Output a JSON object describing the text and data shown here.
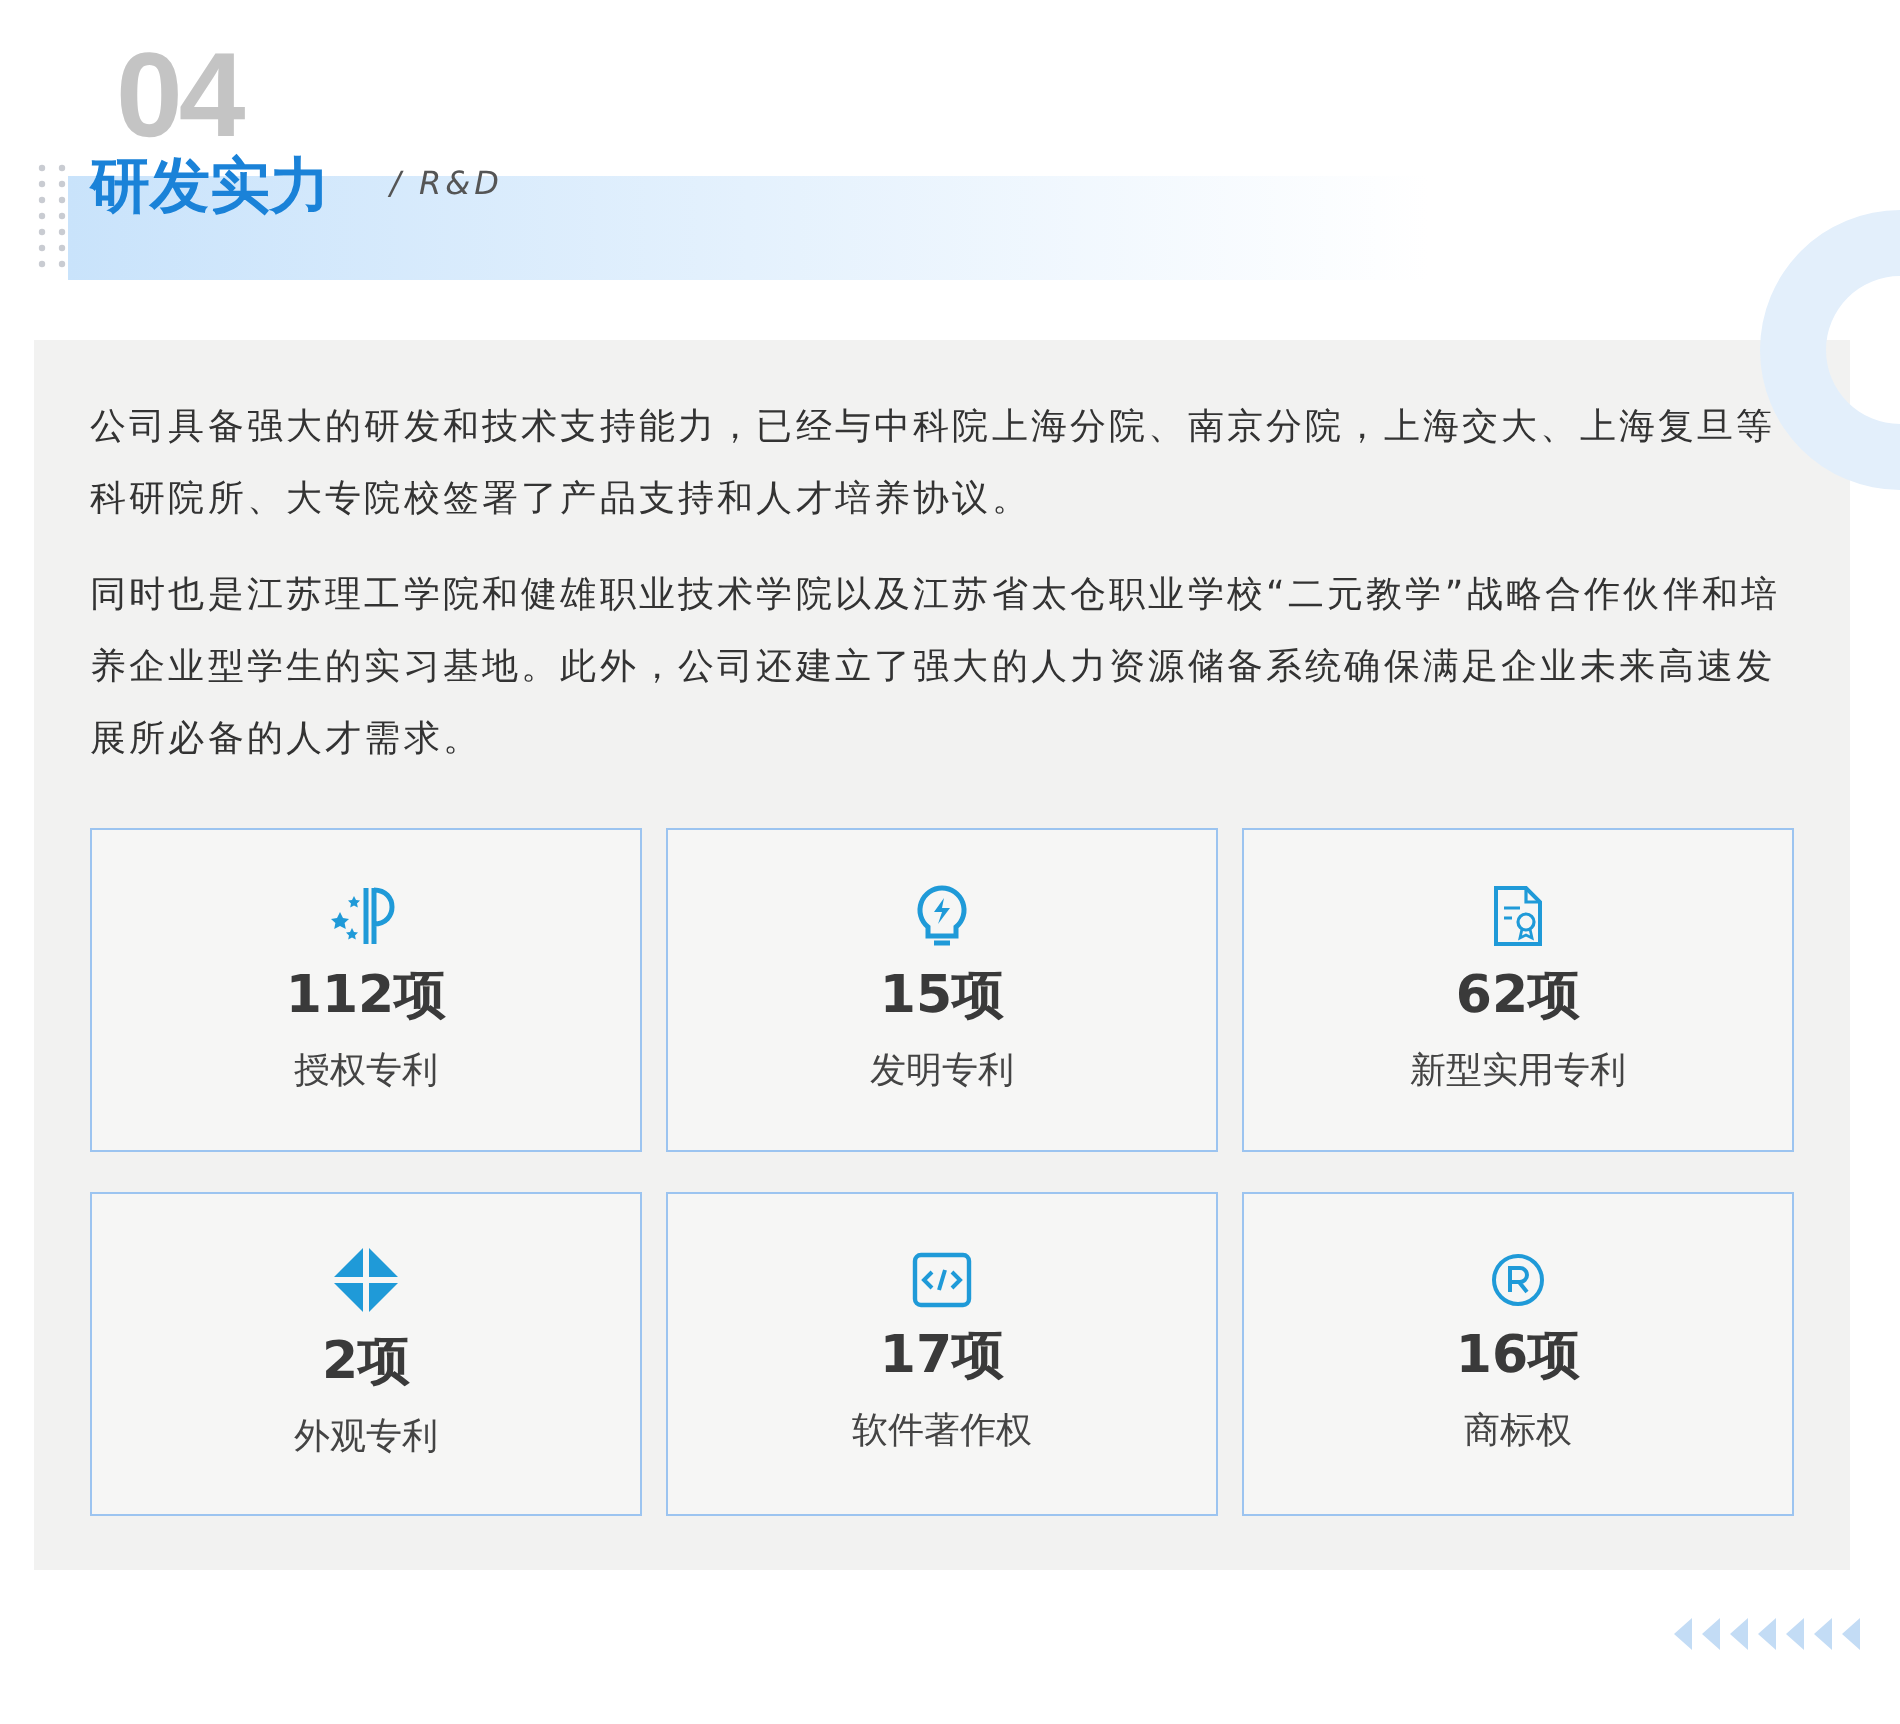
{
  "header": {
    "number": "04",
    "title": "研发实力",
    "subtitle": "/ R&D"
  },
  "paragraphs": [
    "公司具备强大的研发和技术支持能力，已经与中科院上海分院、南京分院，上海交大、上海复旦等科研院所、大专院校签署了产品支持和人才培养协议。",
    "同时也是江苏理工学院和健雄职业技术学院以及江苏省太仓职业学校“二元教学”战略合作伙伴和培养企业型学生的实习基地。此外，公司还建立了强大的人力资源储备系统确保满足企业未来高速发展所必备的人才需求。"
  ],
  "stats": [
    {
      "kind": "patent",
      "value": "112项",
      "label": "授权专利"
    },
    {
      "kind": "invention",
      "value": "15项",
      "label": "发明专利"
    },
    {
      "kind": "certificate",
      "value": "62项",
      "label": "新型实用专利"
    },
    {
      "kind": "design",
      "value": "2项",
      "label": "外观专利"
    },
    {
      "kind": "code",
      "value": "17项",
      "label": "软件著作权"
    },
    {
      "kind": "trademark",
      "value": "16项",
      "label": "商标权"
    }
  ]
}
